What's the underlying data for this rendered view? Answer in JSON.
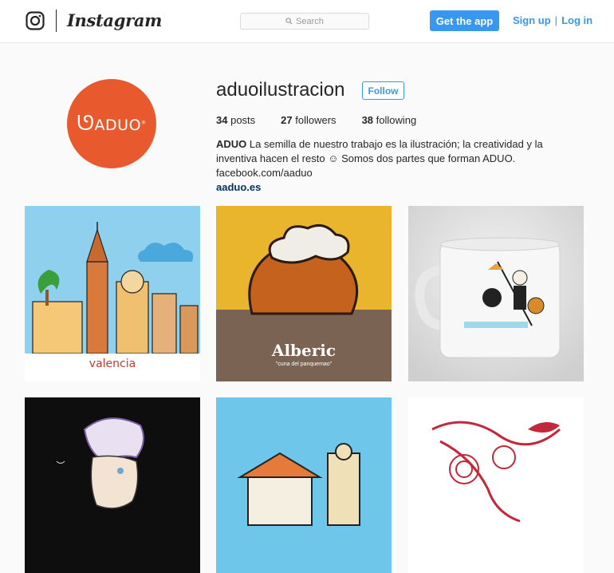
{
  "header": {
    "brand": "Instagram",
    "search_placeholder": "Search",
    "get_app_label": "Get the app",
    "signup_label": "Sign up",
    "separator": "|",
    "login_label": "Log in"
  },
  "profile": {
    "username": "aduoilustracion",
    "follow_label": "Follow",
    "avatar_text": "ADUO",
    "posts_count": "34",
    "posts_label": "posts",
    "followers_count": "27",
    "followers_label": "followers",
    "following_count": "38",
    "following_label": "following",
    "bio_name": "ADUO",
    "bio_text": "La semilla de nuestro trabajo es la ilustración; la creatividad y la inventiva hacen el resto ☺ Somos dos partes que forman ADUO. facebook.com/aaduo",
    "website": "aaduo.es"
  },
  "posts": [
    {
      "caption": "valencia"
    },
    {
      "caption": "Alberic",
      "subcaption": "\"cuna del panquemao\""
    },
    {
      "caption": ""
    }
  ],
  "colors": {
    "accent": "#3897f0",
    "avatar_bg": "#e85a2e"
  }
}
